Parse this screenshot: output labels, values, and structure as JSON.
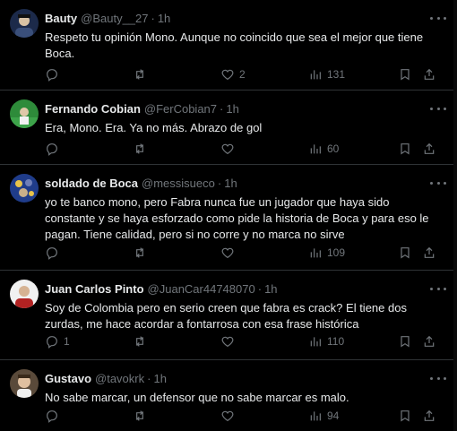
{
  "tweets": [
    {
      "name": "Bauty",
      "handle": "@Bauty__27",
      "dot": "·",
      "time": "1h",
      "text": "Respeto tu opinión Mono. Aunque no coincido que sea el mejor que tiene\nBoca.",
      "replies": "",
      "retweets": "",
      "likes": "2",
      "views": "131",
      "avatar_color": "#3a4f7a"
    },
    {
      "name": "Fernando Cobian",
      "handle": "@FerCobian7",
      "dot": "·",
      "time": "1h",
      "text": "Era, Mono. Era. Ya no más. Abrazo de gol",
      "replies": "",
      "retweets": "",
      "likes": "",
      "views": "60",
      "avatar_color": "#2e8b3a"
    },
    {
      "name": "soldado de Boca",
      "handle": "@messisueco",
      "dot": "·",
      "time": "1h",
      "text": "yo te banco mono, pero Fabra nunca fue un jugador que haya sido\nconstante y se haya esforzado como pide la historia de Boca y para eso le\npagan. Tiene calidad, pero si no corre y no marca no sirve",
      "replies": "",
      "retweets": "",
      "likes": "",
      "views": "109",
      "avatar_color": "#1f3c8a"
    },
    {
      "name": "Juan Carlos Pinto",
      "handle": "@JuanCar44748070",
      "dot": "·",
      "time": "1h",
      "text": "Soy de Colombia pero en serio creen que fabra es crack? El tiene dos\nzurdas, me hace acordar a fontarrosa con esa frase histórica",
      "replies": "1",
      "retweets": "",
      "likes": "",
      "views": "110",
      "avatar_color": "#b22222"
    },
    {
      "name": "Gustavo",
      "handle": "@tavokrk",
      "dot": "·",
      "time": "1h",
      "text": "No sabe marcar, un defensor que no sabe marcar es malo.",
      "replies": "",
      "retweets": "",
      "likes": "",
      "views": "94",
      "avatar_color": "#8a6a4a"
    }
  ]
}
